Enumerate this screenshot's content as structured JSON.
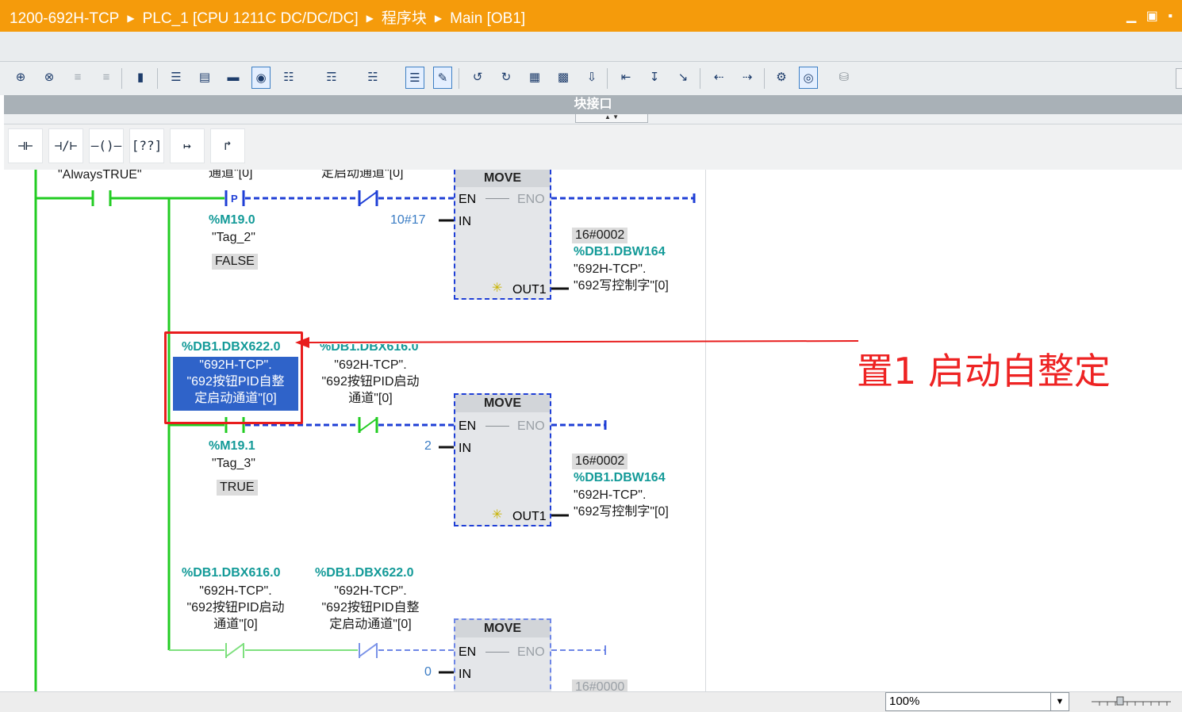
{
  "titlebar": {
    "crumbs": [
      "1200-692H-TCP",
      "PLC_1 [CPU 1211C DC/DC/DC]",
      "程序块",
      "Main [OB1]"
    ],
    "window_buttons": "▁ ▣ ▪"
  },
  "toolbar": {
    "icons": [
      "insert-network-icon",
      "delete-network-icon",
      "insert-row-icon",
      "add-row-icon",
      "network-comment-icon",
      "show-absolute-icon",
      "show-comments-icon",
      "show-symbols-icon",
      "show-favorites-icon",
      "symbol-info-icon",
      "variable-icon",
      "network-overview-icon",
      "list-view-icon",
      "operand-icon",
      "goto-error-icon",
      "close-all-icon",
      "open-all-icon",
      "monitor-icon",
      "watch-icon",
      "download-icon",
      "go-prev-icon",
      "go-next-icon",
      "go-start-icon",
      "step-back-icon",
      "step-forward-icon",
      "call-tree-icon",
      "monitoring-on-icon",
      "database-icon"
    ]
  },
  "block_interface": {
    "label": "块接口"
  },
  "ladder_toolbar": {
    "buttons": [
      {
        "name": "no-contact-button",
        "glyph": "⊣⊢"
      },
      {
        "name": "nc-contact-button",
        "glyph": "⊣/⊢"
      },
      {
        "name": "coil-button",
        "glyph": "–()–"
      },
      {
        "name": "empty-box-button",
        "glyph": "[??]"
      },
      {
        "name": "open-branch-button",
        "glyph": "↦"
      },
      {
        "name": "close-branch-button",
        "glyph": "↱"
      }
    ]
  },
  "network": {
    "header_labels": {
      "always_true": "\"AlwaysTRUE\"",
      "cut1": "通道\"[0]",
      "cut2": "定启动通道\"[0]"
    },
    "rung1": {
      "ptag_addr": "%M19.0",
      "ptag_name": "\"Tag_2\"",
      "ptag_state": "FALSE",
      "in_value": "10#17",
      "move": {
        "title": "MOVE",
        "en": "EN",
        "eno": "ENO",
        "in": "IN",
        "out": "OUT1",
        "out_star": "✳"
      },
      "out_value": "16#0002",
      "out_addr": "%DB1.DBW164",
      "out_name1": "\"692H-TCP\".",
      "out_name2": "\"692写控制字\"[0]"
    },
    "rung2": {
      "contact1_addr": "%DB1.DBX622.0",
      "contact1_name1": "\"692H-TCP\".",
      "contact1_name2": "\"692按钮PID自整",
      "contact1_name3": "定启动通道\"[0]",
      "contact2_addr": "%DB1.DBX616.0",
      "contact2_name1": "\"692H-TCP\".",
      "contact2_name2": "\"692按钮PID启动",
      "contact2_name3": "通道\"[0]",
      "ptag_addr": "%M19.1",
      "ptag_name": "\"Tag_3\"",
      "ptag_state": "TRUE",
      "in_value": "2",
      "move": {
        "title": "MOVE",
        "en": "EN",
        "eno": "ENO",
        "in": "IN",
        "out": "OUT1",
        "out_star": "✳"
      },
      "out_value": "16#0002",
      "out_addr": "%DB1.DBW164",
      "out_name1": "\"692H-TCP\".",
      "out_name2": "\"692写控制字\"[0]"
    },
    "rung3": {
      "contact1_addr": "%DB1.DBX616.0",
      "contact1_name1": "\"692H-TCP\".",
      "contact1_name2": "\"692按钮PID启动",
      "contact1_name3": "通道\"[0]",
      "contact2_addr": "%DB1.DBX622.0",
      "contact2_name1": "\"692H-TCP\".",
      "contact2_name2": "\"692按钮PID自整",
      "contact2_name3": "定启动通道\"[0]",
      "in_value": "0",
      "move": {
        "title": "MOVE",
        "en": "EN",
        "eno": "ENO",
        "in": "IN"
      },
      "out_value": "16#0000"
    }
  },
  "annotation": {
    "text": "置1 启动自整定",
    "color": "#ee2323"
  },
  "statusbar": {
    "zoom": "100%"
  },
  "colors": {
    "powered": "#22cc22",
    "unpowered": "#1f3fd6",
    "accent": "#f59b0b",
    "teal": "#139a98"
  }
}
